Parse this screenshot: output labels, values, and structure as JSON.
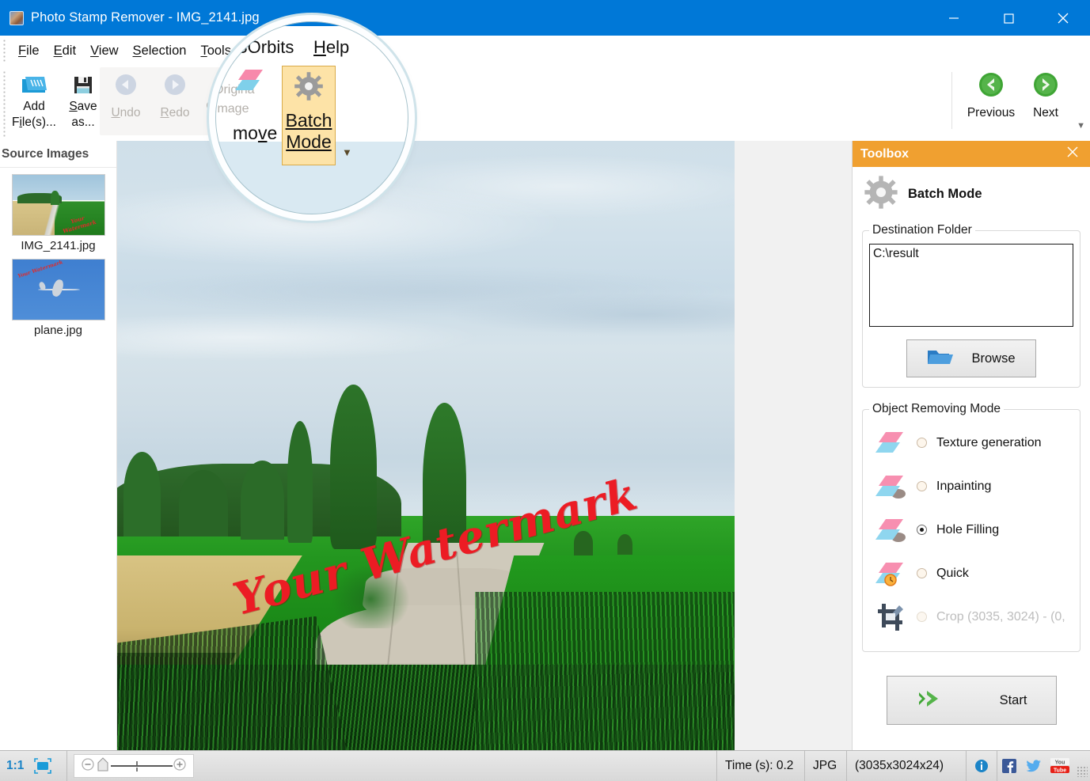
{
  "window": {
    "title": "Photo Stamp Remover - IMG_2141.jpg",
    "app_icon": "photo-stamp-remover-icon",
    "minimize_label": "Minimize",
    "maximize_label": "Maximize",
    "close_label": "Close"
  },
  "menubar": {
    "items": [
      {
        "label": "File",
        "accel": "F"
      },
      {
        "label": "Edit",
        "accel": "E"
      },
      {
        "label": "View",
        "accel": "V"
      },
      {
        "label": "Selection",
        "accel": "S"
      },
      {
        "label": "Tools",
        "accel": "T"
      },
      {
        "label": "SOrbits",
        "accel": ""
      },
      {
        "label": "Help",
        "accel": "H"
      }
    ]
  },
  "ribbon": {
    "buttons": [
      {
        "name": "add-files",
        "line1": "Add",
        "line2": "File(s)...",
        "icon": "add-files-icon",
        "disabled": false
      },
      {
        "name": "save-as",
        "line1": "Save",
        "line2": "as...",
        "icon": "save-icon",
        "disabled": false
      },
      {
        "name": "undo",
        "line1": "Undo",
        "line2": "",
        "icon": "undo-icon",
        "disabled": true
      },
      {
        "name": "redo",
        "line1": "Redo",
        "line2": "",
        "icon": "redo-icon",
        "disabled": true
      },
      {
        "name": "original-image",
        "line1": "Original",
        "line2": "Image",
        "icon": "clock-icon",
        "disabled": true
      },
      {
        "name": "remove",
        "line1": "Remove",
        "line2": "",
        "icon": "eraser-icon",
        "disabled": false
      },
      {
        "name": "batch-mode",
        "line1": "Batch",
        "line2": "Mode",
        "icon": "gear-icon",
        "disabled": false
      },
      {
        "name": "previous",
        "line1": "Previous",
        "line2": "",
        "icon": "previous-arrow-icon",
        "disabled": false
      },
      {
        "name": "next",
        "line1": "Next",
        "line2": "",
        "icon": "next-arrow-icon",
        "disabled": false
      }
    ],
    "overflow_label": "More commands"
  },
  "magnifier": {
    "menu_partial": "SOrbits",
    "menu_help": "Help",
    "remove_partial": "move",
    "batch_line1": "Batch",
    "batch_line2": "Mode",
    "orig_partial_1": "Origina",
    "orig_partial_2": "Image"
  },
  "source_panel": {
    "heading": "Source Images",
    "items": [
      {
        "name": "IMG_2141.jpg",
        "selected": true,
        "thumb": "landscape-road-thumbnail"
      },
      {
        "name": "plane.jpg",
        "selected": false,
        "thumb": "airplane-thumbnail"
      }
    ]
  },
  "canvas": {
    "watermark_text": "Your Watermark",
    "image_name": "landscape-road-field-photo"
  },
  "toolbox": {
    "panel_title": "Toolbox",
    "close_label": "Close toolbox",
    "section_title": "Batch Mode",
    "section_icon": "gear-icon",
    "destination": {
      "legend": "Destination Folder",
      "value": "C:\\result",
      "placeholder": "",
      "browse_label": "Browse",
      "browse_icon": "folder-icon"
    },
    "removing_mode": {
      "legend": "Object Removing Mode",
      "options": [
        {
          "label": "Texture generation",
          "selected": false,
          "disabled": false,
          "icon": "eraser-icon"
        },
        {
          "label": "Inpainting",
          "selected": false,
          "disabled": false,
          "icon": "eraser-shadow-icon"
        },
        {
          "label": "Hole Filling",
          "selected": true,
          "disabled": false,
          "icon": "eraser-shadow-icon"
        },
        {
          "label": "Quick",
          "selected": false,
          "disabled": false,
          "icon": "eraser-clock-icon"
        },
        {
          "label": "Crop (3035, 3024) - (0,",
          "selected": false,
          "disabled": true,
          "icon": "crop-icon"
        }
      ]
    },
    "start_label": "Start",
    "start_icon": "green-arrow-icon"
  },
  "statusbar": {
    "ratio_label": "1:1",
    "fit_icon": "fit-to-window-icon",
    "zoom_out_icon": "zoom-out-icon",
    "zoom_in_icon": "zoom-in-icon",
    "time_label": "Time (s): 0.2",
    "format_label": "JPG",
    "dimensions_label": "(3035x3024x24)",
    "info_icon": "info-icon",
    "facebook_icon": "facebook-icon",
    "twitter_icon": "twitter-icon",
    "youtube_icon": "youtube-icon"
  },
  "colors": {
    "titlebar": "#0078d7",
    "toolbox_header": "#f0a030",
    "highlight": "#fde3a7",
    "accent_green": "#3fa535",
    "watermark": "#ec1c24"
  }
}
